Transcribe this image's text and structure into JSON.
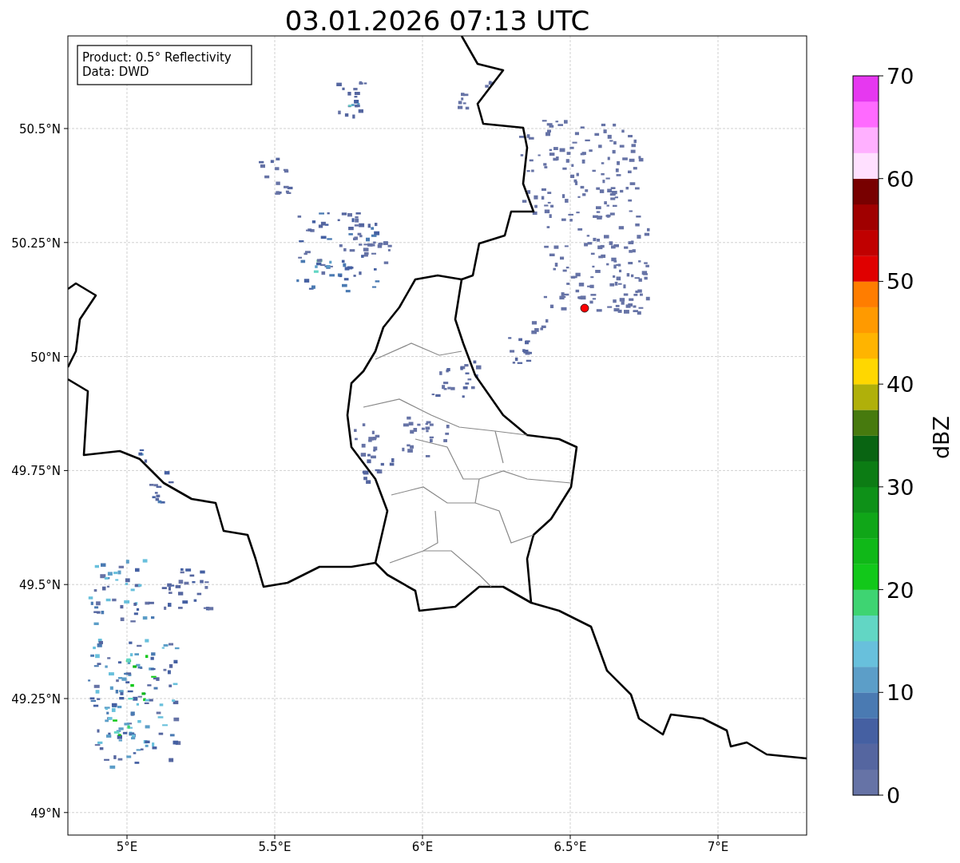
{
  "title": "03.01.2026 07:13 UTC",
  "legend": [
    "Product: 0.5° Reflectivity",
    "Data: DWD"
  ],
  "x_ticks": [
    "5°E",
    "5.5°E",
    "6°E",
    "6.5°E",
    "7°E"
  ],
  "y_ticks": [
    "50.5°N",
    "50.25°N",
    "50°N",
    "49.75°N",
    "49.5°N",
    "49.25°N",
    "49°N"
  ],
  "colorbar": {
    "label": "dBZ",
    "ticks": [
      "70",
      "60",
      "50",
      "40",
      "30",
      "20",
      "10",
      "0"
    ],
    "bins": [
      {
        "color": "#6673a6"
      },
      {
        "color": "#5566a0"
      },
      {
        "color": "#4560a2"
      },
      {
        "color": "#4a7ab2"
      },
      {
        "color": "#5c9ec8"
      },
      {
        "color": "#68c0dc"
      },
      {
        "color": "#62d6c4"
      },
      {
        "color": "#3ed472"
      },
      {
        "color": "#12c81a"
      },
      {
        "color": "#10b818"
      },
      {
        "color": "#10a618"
      },
      {
        "color": "#0e9118"
      },
      {
        "color": "#0c7c14"
      },
      {
        "color": "#096412"
      },
      {
        "color": "#477a0e"
      },
      {
        "color": "#b0b00a"
      },
      {
        "color": "#ffd700"
      },
      {
        "color": "#ffb400"
      },
      {
        "color": "#ff9a00"
      },
      {
        "color": "#ff7d00"
      },
      {
        "color": "#e00000"
      },
      {
        "color": "#c00000"
      },
      {
        "color": "#a00000"
      },
      {
        "color": "#780000"
      },
      {
        "color": "#ffe0ff"
      },
      {
        "color": "#ffb0ff"
      },
      {
        "color": "#ff6aff"
      },
      {
        "color": "#e638f0"
      }
    ]
  }
}
